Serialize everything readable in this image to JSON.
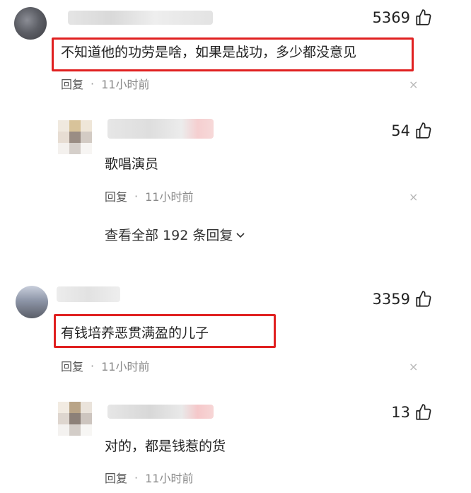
{
  "comments": [
    {
      "likes": "5369",
      "text": "不知道他的功劳是啥，如果是战功，多少都没意见",
      "reply_label": "回复",
      "separator": "·",
      "time": "11小时前",
      "close_symbol": "×",
      "reply": {
        "likes": "54",
        "text": "歌唱演员",
        "reply_label": "回复",
        "separator": "·",
        "time": "11小时前",
        "close_symbol": "×"
      },
      "view_all": "查看全部 192 条回复"
    },
    {
      "likes": "3359",
      "text": "有钱培养恶贯满盈的儿子",
      "reply_label": "回复",
      "separator": "·",
      "time": "11小时前",
      "close_symbol": "×",
      "reply": {
        "likes": "13",
        "text": "对的，都是钱惹的货",
        "reply_label": "回复",
        "separator": "·",
        "time": "11小时前"
      }
    }
  ],
  "colors": {
    "highlight_border": "#e02020",
    "text": "#222222",
    "meta": "#8a8a8a"
  },
  "icons": {
    "like": "thumbs-up-icon",
    "close": "close-icon",
    "expand": "chevron-down-icon"
  }
}
